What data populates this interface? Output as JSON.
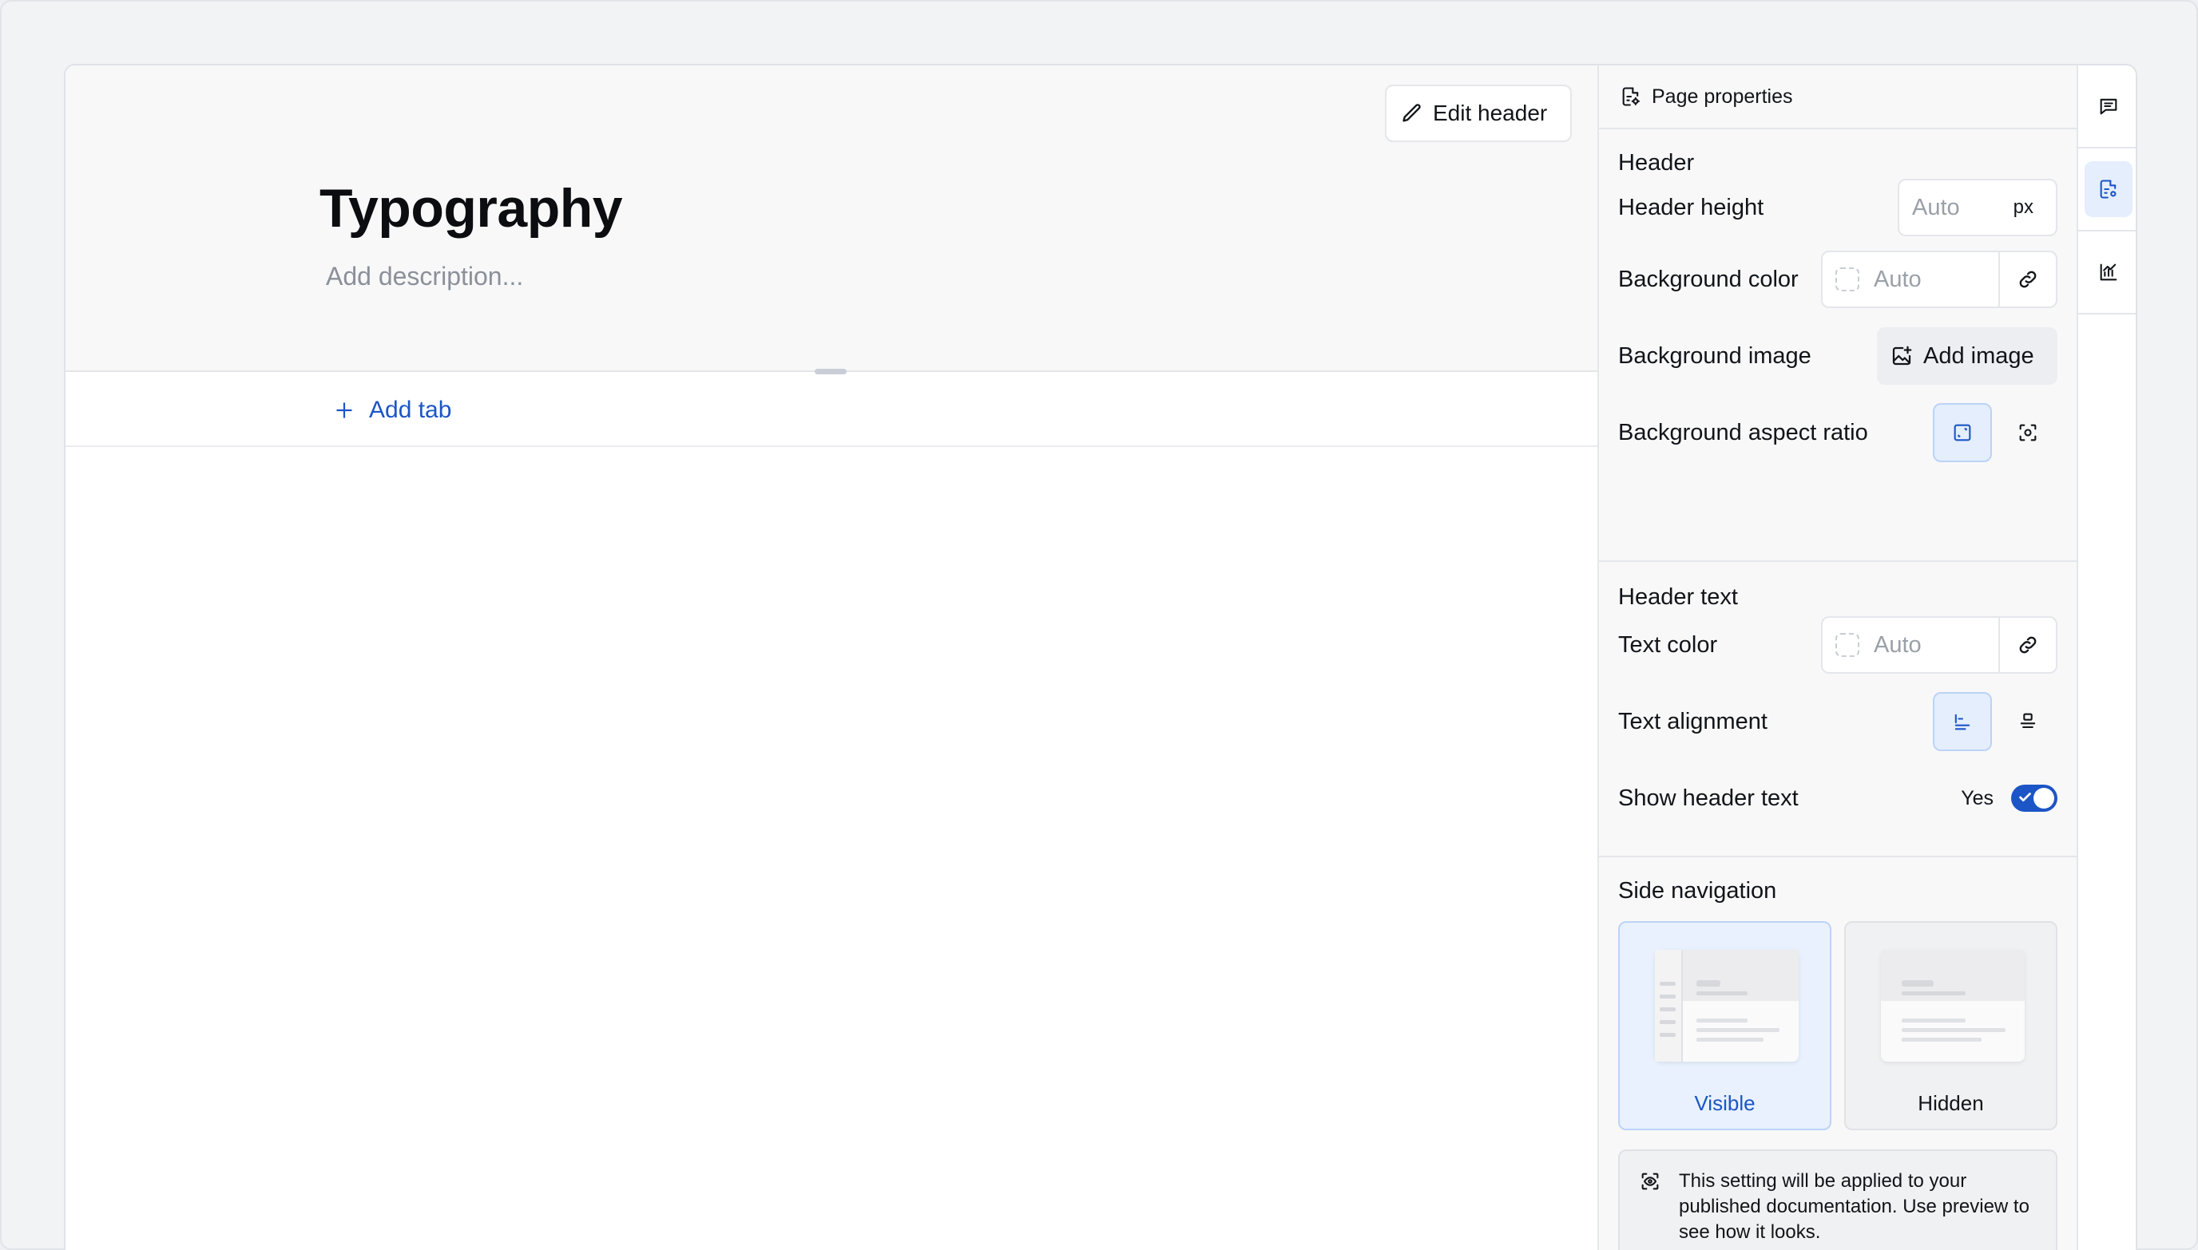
{
  "canvas": {
    "edit_header_label": "Edit header",
    "title": "Typography",
    "description_placeholder": "Add description...",
    "add_tab_label": "Add tab"
  },
  "panel": {
    "title": "Page properties",
    "header_section": {
      "title": "Header",
      "height_label": "Header height",
      "height_placeholder": "Auto",
      "height_unit": "px",
      "bg_color_label": "Background color",
      "bg_color_placeholder": "Auto",
      "bg_image_label": "Background image",
      "add_image_label": "Add image",
      "aspect_label": "Background aspect ratio"
    },
    "header_text_section": {
      "title": "Header text",
      "text_color_label": "Text color",
      "text_color_placeholder": "Auto",
      "alignment_label": "Text alignment",
      "show_label": "Show header text",
      "show_value": "Yes"
    },
    "side_nav_section": {
      "title": "Side navigation",
      "options": [
        {
          "label": "Visible",
          "selected": true
        },
        {
          "label": "Hidden",
          "selected": false
        }
      ],
      "info_text": "This setting will be applied to your published documentation. Use preview to see how it looks."
    }
  },
  "rail": {
    "items": [
      {
        "icon": "comment-icon",
        "active": false
      },
      {
        "icon": "page-settings-icon",
        "active": true
      },
      {
        "icon": "analytics-icon",
        "active": false
      }
    ]
  },
  "colors": {
    "accent": "#1c55c6",
    "accent_bg": "#e4eefc",
    "panel_bg": "#f8f8f9",
    "border": "#e4e6ea"
  }
}
